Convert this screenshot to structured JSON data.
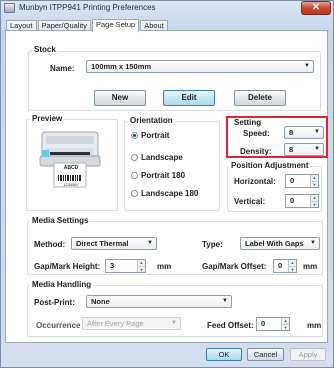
{
  "window": {
    "title": "Munbyn ITPP941 Printing Preferences",
    "close_glyph": "✕"
  },
  "tabs": [
    {
      "label": "Layout"
    },
    {
      "label": "Paper/Quality"
    },
    {
      "label": "Page Setup",
      "active": true
    },
    {
      "label": "About"
    }
  ],
  "stock": {
    "title": "Stock",
    "name_label": "Name:",
    "name_value": "100mm x 150mm",
    "buttons": {
      "new": "New",
      "edit": "Edit",
      "delete": "Delete"
    }
  },
  "preview": {
    "title": "Preview",
    "label_text": "ABCD",
    "barcode_text": "1234567"
  },
  "orientation": {
    "title": "Orientation",
    "options": [
      {
        "label": "Portrait",
        "selected": true
      },
      {
        "label": "Landscape",
        "selected": false
      },
      {
        "label": "Portrait 180",
        "selected": false
      },
      {
        "label": "Landscape 180",
        "selected": false
      }
    ]
  },
  "setting": {
    "title": "Setting",
    "speed_label": "Speed:",
    "speed_value": "8",
    "density_label": "Density:",
    "density_value": "8",
    "highlight_color": "#e0232c"
  },
  "position_adjustment": {
    "title": "Position Adjustment",
    "horizontal_label": "Horizontal:",
    "horizontal_value": "0",
    "vertical_label": "Vertical:",
    "vertical_value": "0"
  },
  "media_settings": {
    "title": "Media Settings",
    "method_label": "Method:",
    "method_value": "Direct Thermal",
    "type_label": "Type:",
    "type_value": "Label With Gaps",
    "gap_height_label": "Gap/Mark Height:",
    "gap_height_value": "3",
    "gap_height_unit": "mm",
    "gap_offset_label": "Gap/Mark Offset:",
    "gap_offset_value": "0",
    "gap_offset_unit": "mm"
  },
  "media_handling": {
    "title": "Media Handling",
    "post_print_label": "Post-Print:",
    "post_print_value": "None",
    "occurrence_label": "Occurrence",
    "occurrence_value": "After Every Page",
    "feed_offset_label": "Feed Offset:",
    "feed_offset_value": "0",
    "feed_offset_unit": "mm"
  },
  "footer": {
    "ok": "OK",
    "cancel": "Cancel",
    "apply": "Apply"
  }
}
